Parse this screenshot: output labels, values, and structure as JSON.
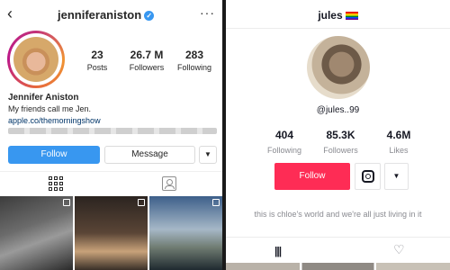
{
  "instagram": {
    "back_icon": "‹",
    "username": "jenniferaniston",
    "verified_icon": "✓",
    "more_icon": "···",
    "stats": [
      {
        "value": "23",
        "label": "Posts"
      },
      {
        "value": "26.7 M",
        "label": "Followers"
      },
      {
        "value": "283",
        "label": "Following"
      }
    ],
    "name": "Jennifer Aniston",
    "bio": "My friends call me Jen.",
    "link": "apple.co/themorningshow",
    "follow_label": "Follow",
    "message_label": "Message",
    "dropdown_icon": "▼",
    "colors": {
      "follow": "#3897f0",
      "link": "#003569"
    }
  },
  "tiktok": {
    "username": "jules",
    "handle": "@jules..99",
    "stats": [
      {
        "value": "404",
        "label": "Following"
      },
      {
        "value": "85.3K",
        "label": "Followers"
      },
      {
        "value": "4.6M",
        "label": "Likes"
      }
    ],
    "follow_label": "Follow",
    "dropdown_icon": "▼",
    "bio": "this is chloe's world and we're all just living in it",
    "grid_icon": "|||",
    "heart_icon": "♡",
    "colors": {
      "follow": "#fe2c55"
    }
  }
}
